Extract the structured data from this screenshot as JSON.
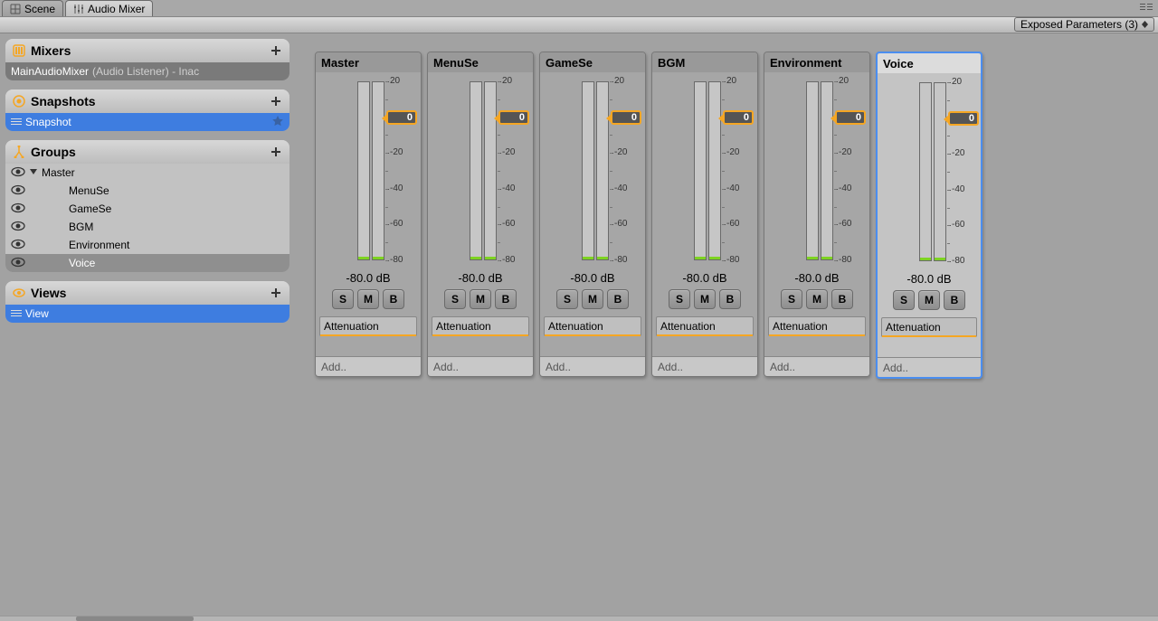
{
  "tabs": {
    "scene": "Scene",
    "audio": "Audio Mixer"
  },
  "toolbar": {
    "exposed_label": "Exposed Parameters (3)"
  },
  "sidebar": {
    "mixers": {
      "title": "Mixers",
      "item_name": "MainAudioMixer",
      "item_detail": "(Audio Listener) - Inac"
    },
    "snapshots": {
      "title": "Snapshots",
      "items": [
        "Snapshot"
      ]
    },
    "groups": {
      "title": "Groups",
      "items": [
        "Master",
        "MenuSe",
        "GameSe",
        "BGM",
        "Environment",
        "Voice"
      ],
      "selected": 5
    },
    "views": {
      "title": "Views",
      "items": [
        "View"
      ]
    }
  },
  "channels": [
    {
      "name": "Master",
      "knob": "0",
      "db": "-80.0 dB",
      "fx": "Attenuation",
      "add": "Add.."
    },
    {
      "name": "MenuSe",
      "knob": "0",
      "db": "-80.0 dB",
      "fx": "Attenuation",
      "add": "Add.."
    },
    {
      "name": "GameSe",
      "knob": "0",
      "db": "-80.0 dB",
      "fx": "Attenuation",
      "add": "Add.."
    },
    {
      "name": "BGM",
      "knob": "0",
      "db": "-80.0 dB",
      "fx": "Attenuation",
      "add": "Add.."
    },
    {
      "name": "Environment",
      "knob": "0",
      "db": "-80.0 dB",
      "fx": "Attenuation",
      "add": "Add.."
    },
    {
      "name": "Voice",
      "knob": "0",
      "db": "-80.0 dB",
      "fx": "Attenuation",
      "add": "Add..",
      "selected": true
    }
  ],
  "scale_labels": [
    "20",
    "0",
    "-20",
    "-40",
    "-60",
    "-80"
  ],
  "smb": {
    "s": "S",
    "m": "M",
    "b": "B"
  }
}
